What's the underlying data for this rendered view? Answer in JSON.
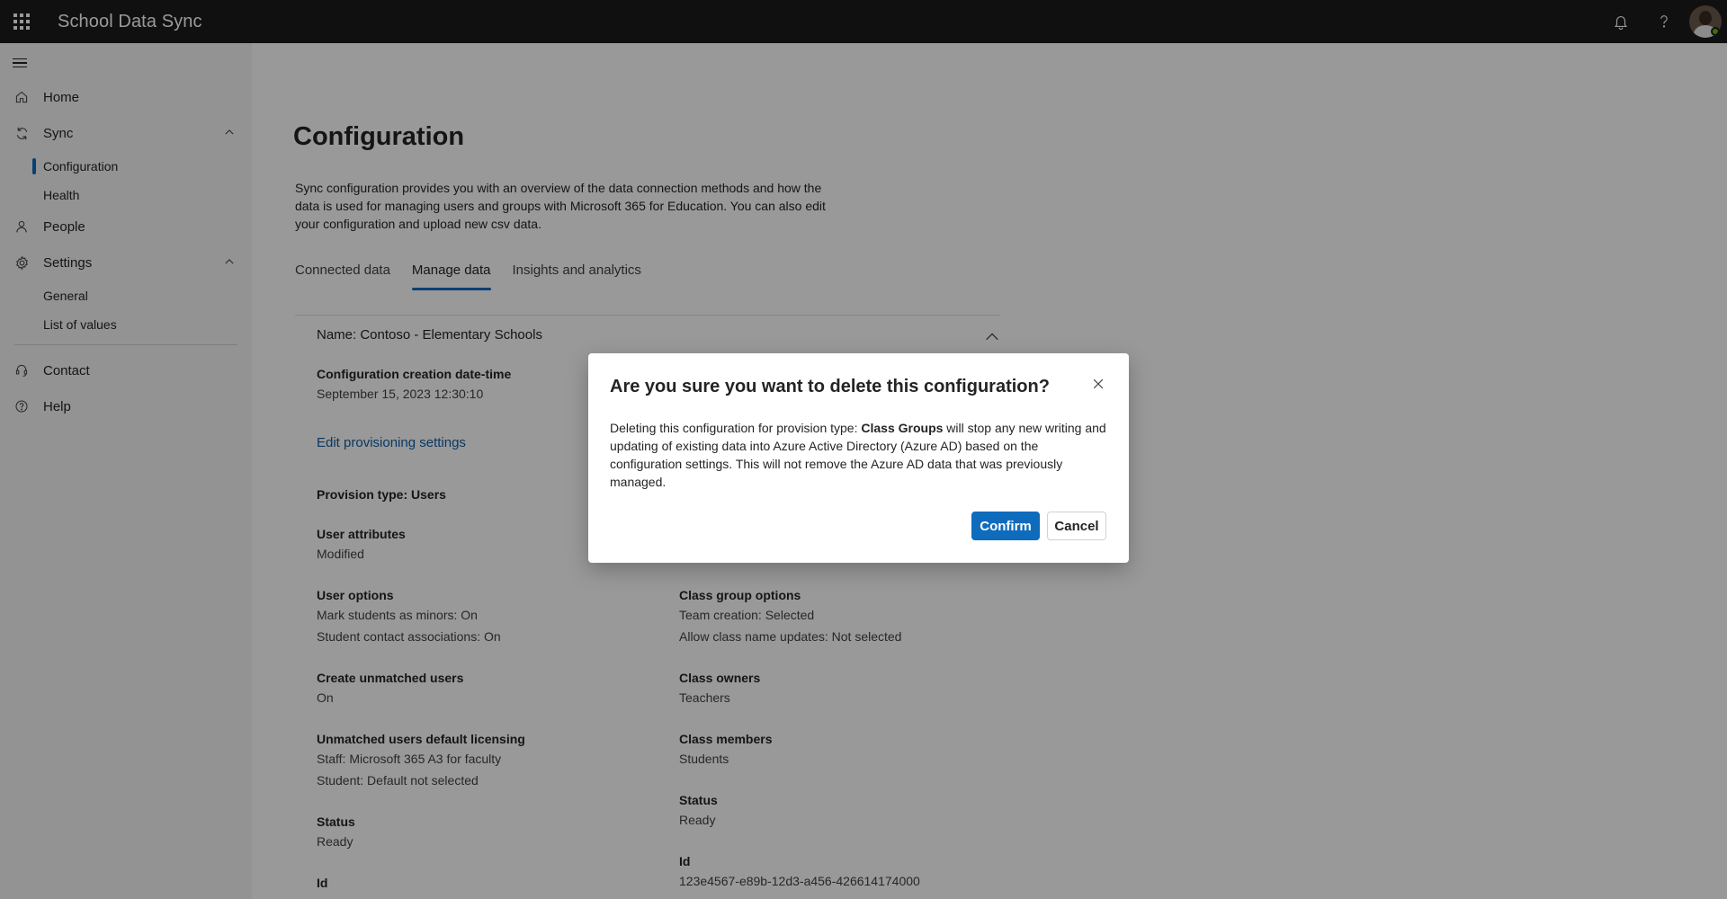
{
  "app": {
    "title": "School Data Sync"
  },
  "sidebar": {
    "home": "Home",
    "sync": "Sync",
    "sync_children": [
      "Configuration",
      "Health"
    ],
    "people": "People",
    "settings": "Settings",
    "settings_children": [
      "General",
      "List of values"
    ],
    "contact": "Contact",
    "help": "Help"
  },
  "page": {
    "title": "Configuration",
    "description": "Sync configuration provides you with an overview of the data connection methods and how the data is used for managing users and groups with Microsoft 365 for Education. You can also edit your configuration and upload new csv data.",
    "tabs": [
      "Connected data",
      "Manage data",
      "Insights and analytics"
    ],
    "active_tab": "Manage data"
  },
  "config": {
    "name": "Name: Contoso - Elementary Schools",
    "creation_label": "Configuration creation date-time",
    "creation_value": "September 15, 2023 12:30:10",
    "edit_link": "Edit provisioning settings",
    "provision_type": "Provision type: Users",
    "left": {
      "user_attributes_label": "User attributes",
      "user_attributes_value": "Modified",
      "user_options_label": "User options",
      "user_options_values": [
        "Mark students as minors: On",
        "Student contact associations: On"
      ],
      "create_unmatched_label": "Create unmatched users",
      "create_unmatched_value": "On",
      "licensing_label": "Unmatched users default licensing",
      "licensing_values": [
        "Staff: Microsoft 365 A3 for faculty",
        "Student: Default not selected"
      ],
      "status_label": "Status",
      "status_value": "Ready",
      "id_label": "Id"
    },
    "right": {
      "class_group_options_label": "Class group options",
      "class_group_options_values": [
        "Team creation: Selected",
        "Allow class name updates: Not selected"
      ],
      "class_owners_label": "Class owners",
      "class_owners_value": "Teachers",
      "class_members_label": "Class members",
      "class_members_value": "Students",
      "status_label": "Status",
      "status_value": "Ready",
      "id_label": "Id",
      "id_value": "123e4567-e89b-12d3-a456-426614174000"
    }
  },
  "dialog": {
    "title": "Are you sure you want to delete this configuration?",
    "body_prefix": "Deleting this configuration for provision type: ",
    "body_bold": "Class Groups",
    "body_suffix": " will stop any new writing and updating of existing data into Azure Active Directory (Azure AD) based on the configuration settings. This will not remove the Azure AD data that was previously managed.",
    "confirm": "Confirm",
    "cancel": "Cancel"
  },
  "colors": {
    "accent": "#0f6cbd",
    "topbar": "#1b1b1b",
    "presence": "#6bb700",
    "link": "#115ea3"
  },
  "icons": [
    "waffle-icon",
    "bell-icon",
    "help-question-icon",
    "home-icon",
    "sync-icon",
    "person-icon",
    "gear-icon",
    "headset-icon",
    "help-circle-icon",
    "chevron-up-icon",
    "close-icon"
  ]
}
